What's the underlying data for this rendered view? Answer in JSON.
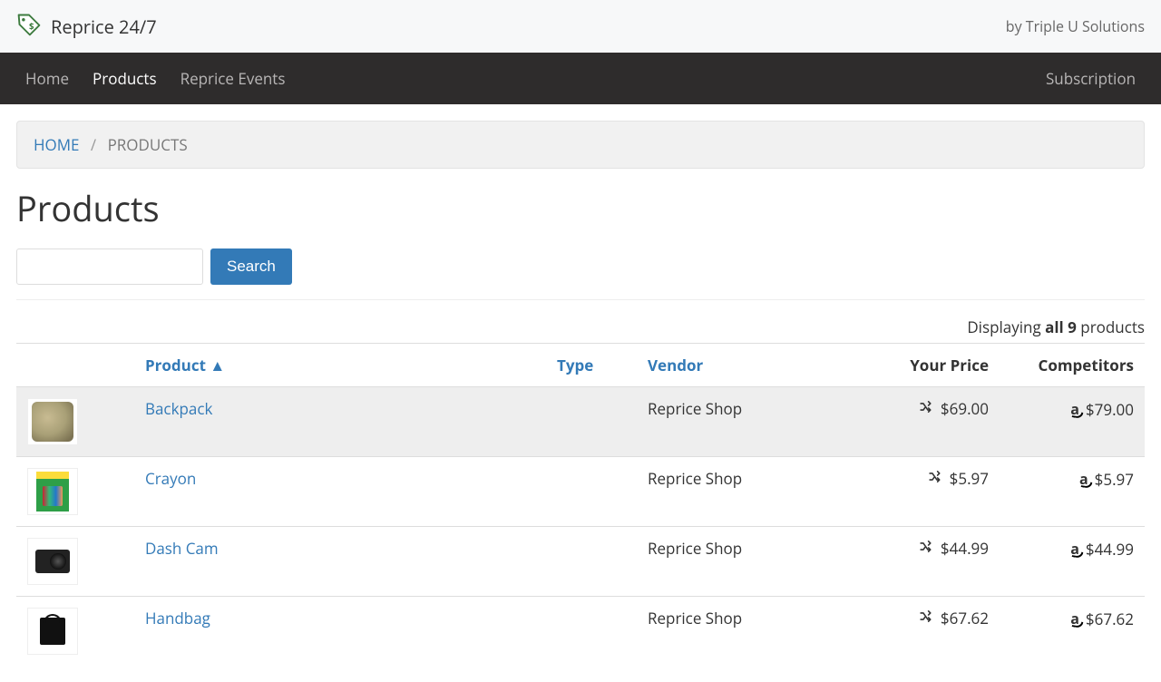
{
  "header": {
    "brand": "Reprice 24/7",
    "byline": "by Triple U Solutions"
  },
  "nav": {
    "left": [
      "Home",
      "Products",
      "Reprice Events"
    ],
    "right": [
      "Subscription"
    ],
    "active_index": 1
  },
  "breadcrumb": {
    "home": "HOME",
    "current": "PRODUCTS"
  },
  "page": {
    "title": "Products",
    "search_button": "Search",
    "search_value": ""
  },
  "status": {
    "prefix": "Displaying ",
    "bold": "all 9",
    "suffix": " products"
  },
  "table": {
    "headers": {
      "product": "Product ▲",
      "type": "Type",
      "vendor": "Vendor",
      "your_price": "Your Price",
      "competitors": "Competitors"
    },
    "rows": [
      {
        "name": "Backpack",
        "type": "",
        "vendor": "Reprice Shop",
        "your_price": "$69.00",
        "competitor_price": "$79.00",
        "thumb": "backpack",
        "highlight": true
      },
      {
        "name": "Crayon",
        "type": "",
        "vendor": "Reprice Shop",
        "your_price": "$5.97",
        "competitor_price": "$5.97",
        "thumb": "crayon",
        "highlight": false
      },
      {
        "name": "Dash Cam",
        "type": "",
        "vendor": "Reprice Shop",
        "your_price": "$44.99",
        "competitor_price": "$44.99",
        "thumb": "dashcam",
        "highlight": false
      },
      {
        "name": "Handbag",
        "type": "",
        "vendor": "Reprice Shop",
        "your_price": "$67.62",
        "competitor_price": "$67.62",
        "thumb": "handbag",
        "highlight": false
      }
    ]
  }
}
